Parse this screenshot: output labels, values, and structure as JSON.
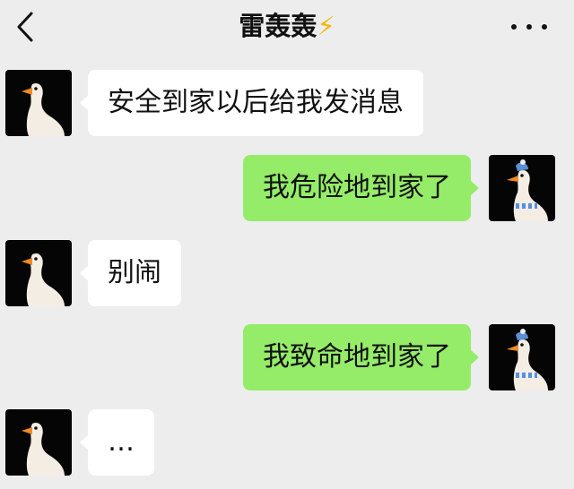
{
  "header": {
    "title": "雷轰轰",
    "title_emoji": "⚡",
    "back_icon": "chevron-left-icon",
    "more_icon": "ellipsis-icon"
  },
  "colors": {
    "background": "#ededed",
    "incoming_bubble": "#ffffff",
    "outgoing_bubble": "#95ec69",
    "avatar_bg": "#050505"
  },
  "messages": [
    {
      "side": "left",
      "text": "安全到家以后给我发消息",
      "avatar": "goose-avatar"
    },
    {
      "side": "right",
      "text": "我危险地到家了",
      "avatar": "goose-scarf-avatar"
    },
    {
      "side": "left",
      "text": "别闹",
      "avatar": "goose-avatar"
    },
    {
      "side": "right",
      "text": "我致命地到家了",
      "avatar": "goose-scarf-avatar"
    },
    {
      "side": "left",
      "text": "…",
      "avatar": "goose-avatar"
    }
  ]
}
